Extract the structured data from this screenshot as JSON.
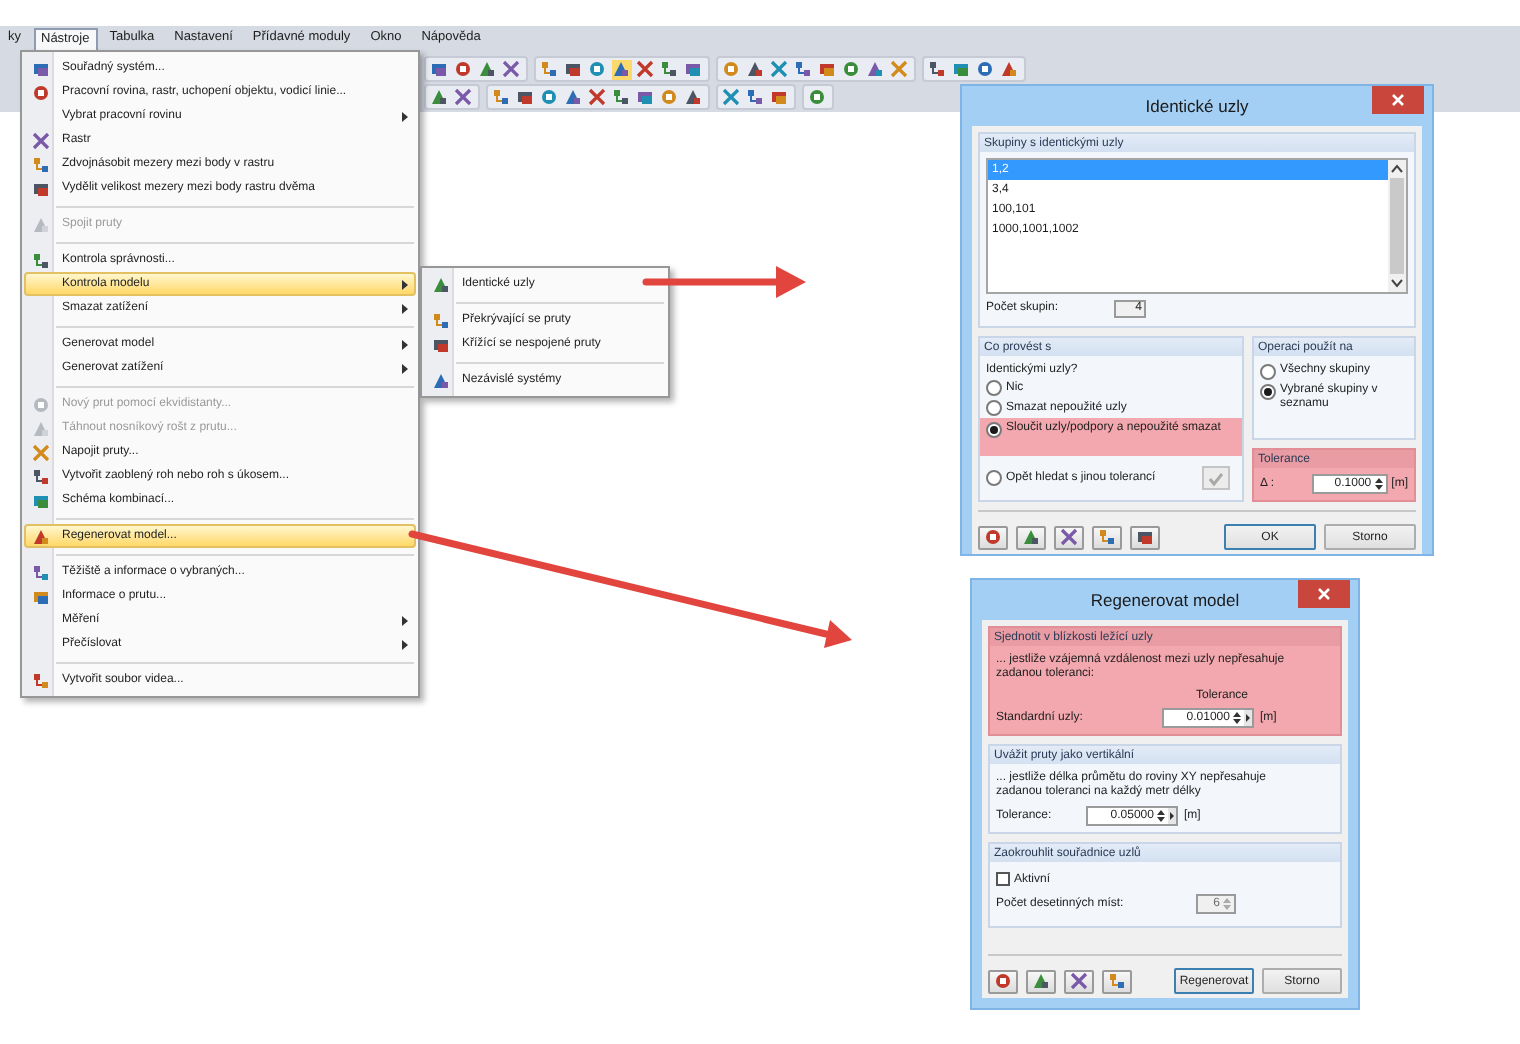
{
  "menubar": [
    {
      "label": "ky",
      "selected": false
    },
    {
      "label": "Nástroje",
      "selected": true
    },
    {
      "label": "Tabulka",
      "selected": false
    },
    {
      "label": "Nastavení",
      "selected": false
    },
    {
      "label": "Přídavné moduly",
      "selected": false
    },
    {
      "label": "Okno",
      "selected": false
    },
    {
      "label": "Nápověda",
      "selected": false
    }
  ],
  "menu": {
    "items": [
      {
        "kind": "item",
        "label": "Souřadný systém...",
        "icon": true,
        "submenu": false,
        "disabled": false,
        "highlighted": false
      },
      {
        "kind": "item",
        "label": "Pracovní rovina, rastr, uchopení objektu, vodicí linie...",
        "icon": true,
        "submenu": false,
        "disabled": false,
        "highlighted": false
      },
      {
        "kind": "item",
        "label": "Vybrat pracovní rovinu",
        "icon": false,
        "submenu": true,
        "disabled": false,
        "highlighted": false
      },
      {
        "kind": "item",
        "label": "Rastr",
        "icon": true,
        "submenu": false,
        "disabled": false,
        "highlighted": false
      },
      {
        "kind": "item",
        "label": "Zdvojnásobit mezery mezi body v rastru",
        "icon": true,
        "submenu": false,
        "disabled": false,
        "highlighted": false
      },
      {
        "kind": "item",
        "label": "Vydělit velikost mezery mezi body rastru dvěma",
        "icon": true,
        "submenu": false,
        "disabled": false,
        "highlighted": false
      },
      {
        "kind": "separator"
      },
      {
        "kind": "item",
        "label": "Spojit pruty",
        "icon": true,
        "submenu": false,
        "disabled": true,
        "highlighted": false
      },
      {
        "kind": "separator"
      },
      {
        "kind": "item",
        "label": "Kontrola správnosti...",
        "icon": true,
        "submenu": false,
        "disabled": false,
        "highlighted": false
      },
      {
        "kind": "item",
        "label": "Kontrola modelu",
        "icon": false,
        "submenu": true,
        "disabled": false,
        "highlighted": true
      },
      {
        "kind": "item",
        "label": "Smazat zatížení",
        "icon": false,
        "submenu": true,
        "disabled": false,
        "highlighted": false
      },
      {
        "kind": "separator"
      },
      {
        "kind": "item",
        "label": "Generovat model",
        "icon": false,
        "submenu": true,
        "disabled": false,
        "highlighted": false
      },
      {
        "kind": "item",
        "label": "Generovat zatížení",
        "icon": false,
        "submenu": true,
        "disabled": false,
        "highlighted": false
      },
      {
        "kind": "separator"
      },
      {
        "kind": "item",
        "label": "Nový prut pomocí ekvidistanty...",
        "icon": true,
        "submenu": false,
        "disabled": true,
        "highlighted": false
      },
      {
        "kind": "item",
        "label": "Táhnout nosníkový rošt z prutu...",
        "icon": true,
        "submenu": false,
        "disabled": true,
        "highlighted": false
      },
      {
        "kind": "item",
        "label": "Napojit pruty...",
        "icon": true,
        "submenu": false,
        "disabled": false,
        "highlighted": false
      },
      {
        "kind": "item",
        "label": "Vytvořit zaoblený roh nebo roh s úkosem...",
        "icon": true,
        "submenu": false,
        "disabled": false,
        "highlighted": false
      },
      {
        "kind": "item",
        "label": "Schéma kombinací...",
        "icon": true,
        "submenu": false,
        "disabled": false,
        "highlighted": false
      },
      {
        "kind": "separator"
      },
      {
        "kind": "item",
        "label": "Regenerovat model...",
        "icon": true,
        "submenu": false,
        "disabled": false,
        "highlighted": true
      },
      {
        "kind": "separator"
      },
      {
        "kind": "item",
        "label": "Těžiště a informace o vybraných...",
        "icon": true,
        "submenu": false,
        "disabled": false,
        "highlighted": false
      },
      {
        "kind": "item",
        "label": "Informace o prutu...",
        "icon": true,
        "submenu": false,
        "disabled": false,
        "highlighted": false
      },
      {
        "kind": "item",
        "label": "Měření",
        "icon": false,
        "submenu": true,
        "disabled": false,
        "highlighted": false
      },
      {
        "kind": "item",
        "label": "Přečíslovat",
        "icon": false,
        "submenu": true,
        "disabled": false,
        "highlighted": false
      },
      {
        "kind": "separator"
      },
      {
        "kind": "item",
        "label": "Vytvořit soubor videa...",
        "icon": true,
        "submenu": false,
        "disabled": false,
        "highlighted": false
      }
    ]
  },
  "submenu": {
    "items": [
      {
        "kind": "item",
        "label": "Identické uzly"
      },
      {
        "kind": "separator"
      },
      {
        "kind": "item",
        "label": "Překrývající se pruty"
      },
      {
        "kind": "item",
        "label": "Křížící se nespojené pruty"
      },
      {
        "kind": "separator"
      },
      {
        "kind": "item",
        "label": "Nezávislé systémy"
      }
    ]
  },
  "identical_nodes_dialog": {
    "title": "Identické uzly",
    "groups_panel": {
      "title": "Skupiny s identickými uzly",
      "items": [
        {
          "label": "1,2",
          "selected": true
        },
        {
          "label": "3,4",
          "selected": false
        },
        {
          "label": "100,101",
          "selected": false
        },
        {
          "label": "1000,1001,1002",
          "selected": false
        }
      ],
      "count_label": "Počet skupin:",
      "count_value": "4"
    },
    "action_panel": {
      "title": "Co provést s",
      "question": "Identickými uzly?",
      "options": [
        {
          "label": "Nic",
          "selected": false,
          "highlighted": false
        },
        {
          "label": "Smazat nepoužité uzly",
          "selected": false,
          "highlighted": false
        },
        {
          "label": "Sloučit uzly/podpory a nepoužité smazat",
          "selected": true,
          "highlighted": true
        }
      ],
      "search_again": {
        "label": "Opět hledat s jinou tolerancí",
        "selected": false
      }
    },
    "apply_panel": {
      "title": "Operaci použít na",
      "options": [
        {
          "label": "Všechny skupiny",
          "selected": false
        },
        {
          "label": "Vybrané skupiny v seznamu",
          "selected": true
        }
      ]
    },
    "tolerance_panel": {
      "title": "Tolerance",
      "highlighted": true,
      "label": "Δ :",
      "value": "0.1000",
      "unit": "[m]"
    },
    "buttons": [
      {
        "label": "OK",
        "default": true
      },
      {
        "label": "Storno",
        "default": false
      }
    ]
  },
  "regenerate_dialog": {
    "title": "Regenerovat model",
    "sections": [
      {
        "kind": "tolerance",
        "title": "Sjednotit v blízkosti ležící uzly",
        "highlighted": true,
        "note": "... jestliže vzájemná vzdálenost mezi uzly nepřesahuje zadanou toleranci:",
        "column_header": "Tolerance",
        "label": "Standardní uzly:",
        "value": "0.01000",
        "unit": "[m]"
      },
      {
        "kind": "tolerance",
        "title": "Uvážit pruty jako vertikální",
        "highlighted": false,
        "note": "... jestliže délka průmětu do roviny XY nepřesahuje zadanou toleranci na každý metr délky",
        "label": "Tolerance:",
        "value": "0.05000",
        "unit": "[m]"
      },
      {
        "kind": "rounding",
        "title": "Zaokrouhlit souřadnice uzlů",
        "highlighted": false,
        "checkbox": {
          "label": "Aktivní",
          "checked": false
        },
        "label": "Počet desetinných míst:",
        "value": "6",
        "disabled": true
      }
    ],
    "buttons": [
      {
        "label": "Regenerovat",
        "default": true
      },
      {
        "label": "Storno",
        "default": false
      }
    ]
  }
}
